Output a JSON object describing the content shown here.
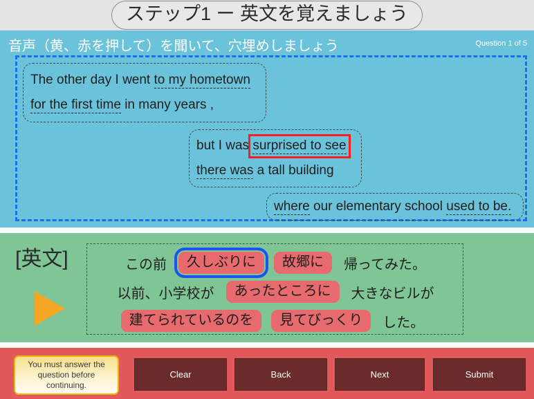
{
  "titlebar": {
    "title": "ステップ1 ー 英文を覚えましょう"
  },
  "english_panel": {
    "instruction": "音声（黄、赤を押して）を聞いて、穴埋めしましょう",
    "question_counter": "Question 1 of 5",
    "sentences": [
      {
        "lines": [
          [
            {
              "text": "The other day I went ",
              "blank": false
            },
            {
              "text": "to my hometown",
              "blank": true,
              "highlight": "none"
            }
          ],
          [
            {
              "text": "for the first time",
              "blank": true,
              "highlight": "none"
            },
            {
              "text": " in many years ,",
              "blank": false
            }
          ]
        ]
      },
      {
        "lines": [
          [
            {
              "text": "but I was ",
              "blank": false
            },
            {
              "text": "surprised to see",
              "blank": true,
              "highlight": "red"
            }
          ],
          [
            {
              "text": "there was",
              "blank": true,
              "highlight": "none"
            },
            {
              "text": " a tall building",
              "blank": false
            }
          ]
        ]
      },
      {
        "lines": [
          [
            {
              "text": "where",
              "blank": true,
              "highlight": "none"
            },
            {
              "text": " our elementary school ",
              "blank": false
            },
            {
              "text": "used to be.",
              "blank": true,
              "highlight": "none"
            }
          ]
        ]
      }
    ]
  },
  "japanese_panel": {
    "label": "[英文]",
    "play_icon": "play-triangle-icon",
    "rows": [
      [
        {
          "text": "この前",
          "type": "plain"
        },
        {
          "text": "久しぶりに",
          "type": "chip",
          "selected": true
        },
        {
          "text": "故郷に",
          "type": "chip",
          "selected": false
        },
        {
          "text": "帰ってみた。",
          "type": "plain"
        }
      ],
      [
        {
          "text": "以前、小学校が",
          "type": "plain"
        },
        {
          "text": "あったところに",
          "type": "chip",
          "selected": false
        },
        {
          "text": "大きなビルが",
          "type": "plain"
        }
      ],
      [
        {
          "text": "建てられているのを",
          "type": "chip",
          "selected": false
        },
        {
          "text": "見てびっくり",
          "type": "chip",
          "selected": false
        },
        {
          "text": "した。",
          "type": "plain"
        }
      ]
    ]
  },
  "bottom_bar": {
    "warning": "You must answer the question before continuing.",
    "buttons": [
      {
        "id": "clear",
        "label": "Clear"
      },
      {
        "id": "back",
        "label": "Back"
      },
      {
        "id": "next",
        "label": "Next"
      },
      {
        "id": "submit",
        "label": "Submit"
      }
    ]
  },
  "colors": {
    "titlebar_bg": "#e4e4e4",
    "cyan_bg": "#6ac3da",
    "green_bg": "#7fc596",
    "red_bar_bg": "#e2595c",
    "button_bg": "#6b2b2b",
    "chip_bg": "#e76a6e",
    "dropzone_border": "#1a6ff0",
    "highlight_red": "#ff1c1c",
    "highlight_blue": "#1a55f0",
    "play_icon": "#f5a623",
    "warning_border": "#e8b80a"
  }
}
